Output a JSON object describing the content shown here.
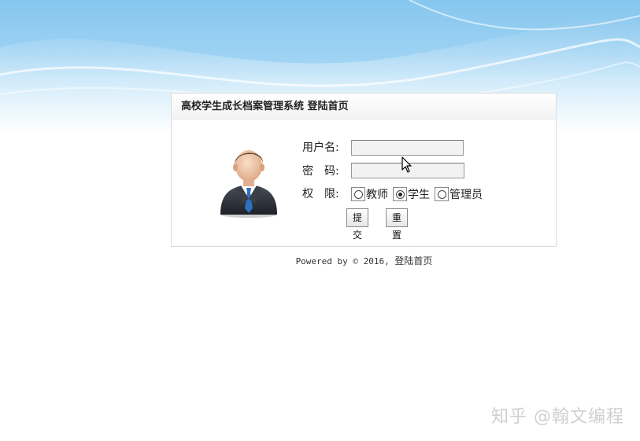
{
  "panel": {
    "title": "高校学生成长档案管理系统 登陆首页"
  },
  "form": {
    "username_label": "用户名:",
    "username_value": "",
    "password_label": "密　码:",
    "password_value": "",
    "role_label": "权　限:",
    "roles": [
      {
        "label": "教师",
        "selected": false
      },
      {
        "label": "学生",
        "selected": true
      },
      {
        "label": "管理员",
        "selected": false
      }
    ],
    "submit_label": "提交",
    "reset_label": "重置"
  },
  "footer": {
    "prefix": "Powered by © 2016, ",
    "site": "登陆首页"
  },
  "watermark": "知乎 @翰文编程",
  "colors": {
    "sky_top": "#7fc2ec",
    "suit": "#2b2f36",
    "tie": "#2f6fbf",
    "skin": "#f0c9a8",
    "hair": "#5a3a22"
  },
  "icons": {
    "avatar": "user-avatar-icon",
    "cursor": "mouse-pointer-icon"
  }
}
